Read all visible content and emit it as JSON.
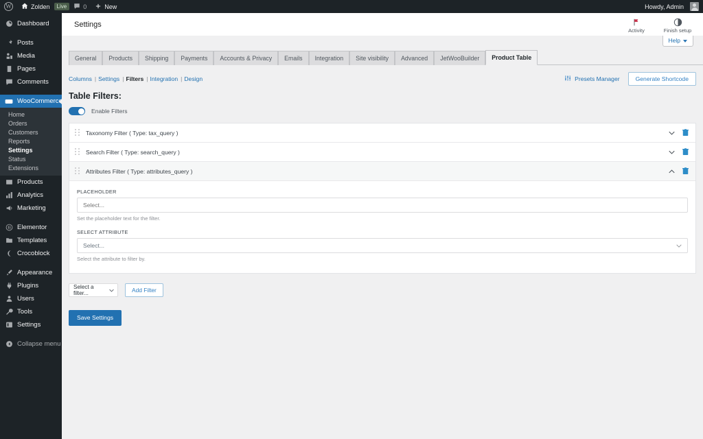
{
  "adminbar": {
    "logo_icon": "wordpress-logo-icon",
    "site_icon": "home-icon",
    "site_name": "Zolden",
    "live_badge": "Live",
    "comments_icon": "comment-bubble-icon",
    "comments_count": "0",
    "new_icon": "plus-icon",
    "new_label": "New",
    "howdy": "Howdy, Admin",
    "avatar": "user-avatar"
  },
  "sidebar": {
    "items": [
      {
        "label": "Dashboard",
        "icon": "dashboard-icon"
      },
      {
        "label": "Posts",
        "icon": "pin-icon"
      },
      {
        "label": "Media",
        "icon": "media-icon"
      },
      {
        "label": "Pages",
        "icon": "page-icon"
      },
      {
        "label": "Comments",
        "icon": "comment-bubble-icon"
      },
      {
        "label": "WooCommerce",
        "icon": "woocommerce-icon",
        "active": true
      },
      {
        "label": "Products",
        "icon": "products-icon"
      },
      {
        "label": "Analytics",
        "icon": "bar-chart-icon"
      },
      {
        "label": "Marketing",
        "icon": "megaphone-icon"
      },
      {
        "label": "Elementor",
        "icon": "elementor-icon"
      },
      {
        "label": "Templates",
        "icon": "folder-icon"
      },
      {
        "label": "Crocoblock",
        "icon": "crocoblock-moon-icon"
      },
      {
        "label": "Appearance",
        "icon": "brush-icon"
      },
      {
        "label": "Plugins",
        "icon": "plug-icon"
      },
      {
        "label": "Users",
        "icon": "users-icon"
      },
      {
        "label": "Tools",
        "icon": "wrench-icon"
      },
      {
        "label": "Settings",
        "icon": "settings-gear-icon"
      },
      {
        "label": "Collapse menu",
        "icon": "collapse-icon"
      }
    ],
    "woo_submenu": [
      {
        "label": "Home"
      },
      {
        "label": "Orders"
      },
      {
        "label": "Customers"
      },
      {
        "label": "Reports"
      },
      {
        "label": "Settings",
        "current": true
      },
      {
        "label": "Status"
      },
      {
        "label": "Extensions"
      }
    ]
  },
  "woo_header": {
    "title": "Settings",
    "activity": {
      "label": "Activity",
      "icon": "flag-icon"
    },
    "finish_setup": {
      "label": "Finish setup",
      "icon": "half-circle-icon"
    }
  },
  "help_tab": {
    "label": "Help",
    "icon": "chevron-down-icon"
  },
  "tabs": [
    {
      "label": "General"
    },
    {
      "label": "Products"
    },
    {
      "label": "Shipping"
    },
    {
      "label": "Payments"
    },
    {
      "label": "Accounts & Privacy"
    },
    {
      "label": "Emails"
    },
    {
      "label": "Integration"
    },
    {
      "label": "Site visibility"
    },
    {
      "label": "Advanced"
    },
    {
      "label": "JetWooBuilder"
    },
    {
      "label": "Product Table",
      "active": true
    }
  ],
  "subnav": {
    "links": [
      {
        "label": "Columns"
      },
      {
        "label": "Settings"
      },
      {
        "label": "Filters",
        "current": true
      },
      {
        "label": "Integration"
      },
      {
        "label": "Design"
      }
    ],
    "presets_manager": {
      "label": "Presets Manager",
      "icon": "sliders-icon"
    },
    "generate_shortcode": "Generate Shortcode"
  },
  "main": {
    "title": "Table Filters:",
    "enable_filters": {
      "label": "Enable Filters",
      "on": true
    },
    "filters": [
      {
        "name": "Taxonomy Filter ( Type: tax_query )",
        "expanded": false
      },
      {
        "name": "Search Filter ( Type: search_query )",
        "expanded": false
      },
      {
        "name": "Attributes Filter ( Type: attributes_query )",
        "expanded": true
      }
    ],
    "expanded_fields": {
      "placeholder_label": "PLACEHOLDER",
      "placeholder_value": "",
      "placeholder_placeholder": "Select...",
      "placeholder_help": "Set the placeholder text for the filter.",
      "attribute_label": "SELECT ATTRIBUTE",
      "attribute_value": "Select...",
      "attribute_help": "Select the attribute to filter by."
    },
    "add_filter_select": "Select a filter...",
    "add_filter_button": "Add Filter",
    "save_button": "Save Settings"
  },
  "colors": {
    "admin_dark": "#1d2327",
    "accent_blue": "#2271b1",
    "link_blue": "#3582c4",
    "trash_blue": "#2e8dc8"
  }
}
